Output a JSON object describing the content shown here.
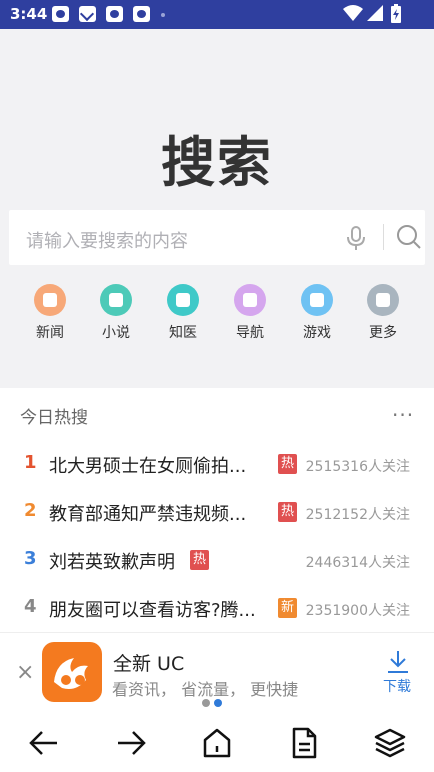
{
  "status_bar": {
    "time": "3:44"
  },
  "page": {
    "big_title": "搜索"
  },
  "search": {
    "placeholder": "请输入要搜索的内容"
  },
  "shortcuts": [
    {
      "label": "新闻",
      "color": "#f7a878",
      "icon": "news-icon"
    },
    {
      "label": "小说",
      "color": "#4dcab8",
      "icon": "novel-icon"
    },
    {
      "label": "知医",
      "color": "#3fc9c8",
      "icon": "medical-icon"
    },
    {
      "label": "导航",
      "color": "#d5a6ee",
      "icon": "navigation-icon"
    },
    {
      "label": "游戏",
      "color": "#6fc2f3",
      "icon": "game-icon"
    },
    {
      "label": "更多",
      "color": "#a9b5bf",
      "icon": "more-icon"
    }
  ],
  "hot": {
    "title": "今日热搜",
    "more": "···",
    "items": [
      {
        "rank": "1",
        "rank_color": "#e4532f",
        "text": "北大男硕士在女厕偷拍...",
        "tag": "热",
        "tag_color": "#e05050",
        "count": "2515316人关注"
      },
      {
        "rank": "2",
        "rank_color": "#f08a30",
        "text": "教育部通知严禁违规频...",
        "tag": "热",
        "tag_color": "#e05050",
        "count": "2512152人关注"
      },
      {
        "rank": "3",
        "rank_color": "#3b7fd9",
        "text": "刘若英致歉声明",
        "tag": "热",
        "tag_color": "#e05050",
        "count": "2446314人关注"
      },
      {
        "rank": "4",
        "rank_color": "#888888",
        "text": "朋友圈可以查看访客?腾...",
        "tag": "新",
        "tag_color": "#f08a30",
        "count": "2351900人关注"
      }
    ]
  },
  "banner": {
    "close": "×",
    "app_name": "全新 UC",
    "description": "看资讯，  省流量，  更快捷",
    "download_label": "下载",
    "accent": "#2f7ad8",
    "pager": [
      "#999999",
      "#2f7ad8"
    ]
  },
  "bottom_nav": [
    {
      "icon": "back-arrow-icon"
    },
    {
      "icon": "forward-arrow-icon"
    },
    {
      "icon": "home-icon"
    },
    {
      "icon": "document-icon"
    },
    {
      "icon": "layers-icon"
    }
  ]
}
